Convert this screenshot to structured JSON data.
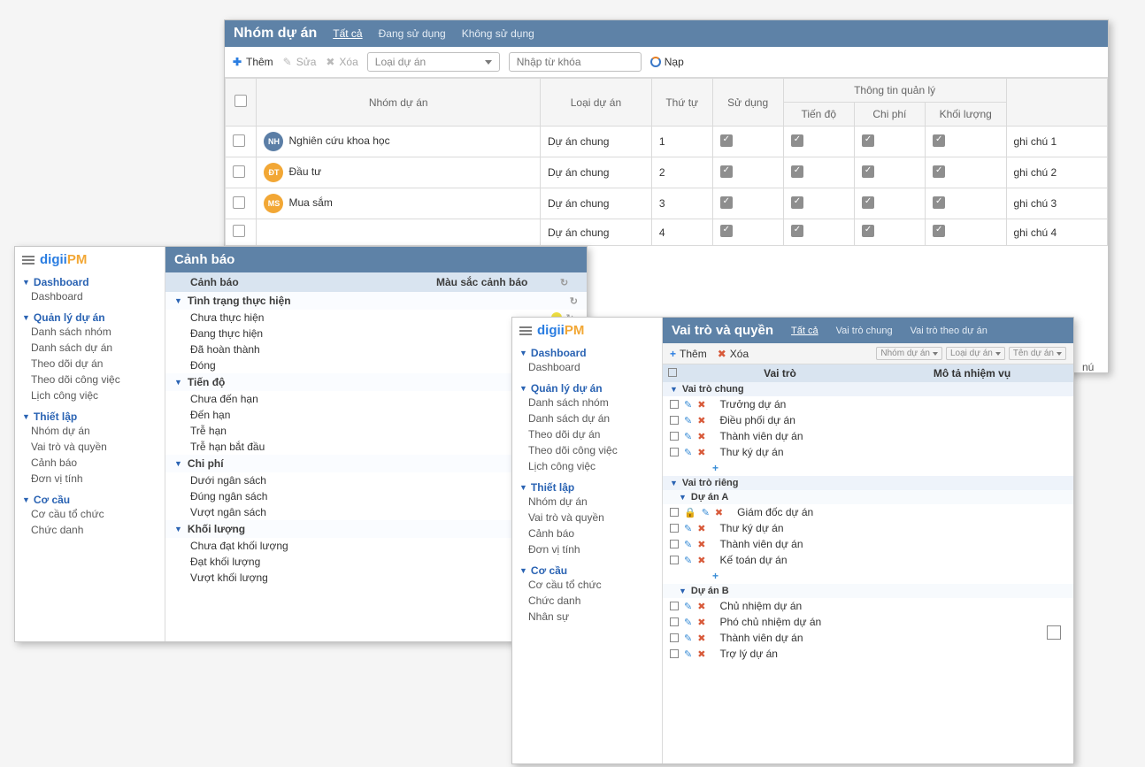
{
  "back": {
    "title": "Nhóm dự án",
    "tabs": [
      "Tất cả",
      "Đang sử dụng",
      "Không sử dụng"
    ],
    "toolbar": {
      "add": "Thêm",
      "edit": "Sửa",
      "del": "Xóa",
      "reload": "Nạp",
      "sel_placeholder": "Loại dự án",
      "search_placeholder": "Nhập từ khóa"
    },
    "headers": {
      "chk": "",
      "name": "Nhóm dự án",
      "type": "Loại dự án",
      "order": "Thứ tự",
      "use": "Sử dụng",
      "info_group": "Thông tin quản lý",
      "prog": "Tiến độ",
      "cost": "Chi phí",
      "vol": "Khối lượng",
      "note": ""
    },
    "rows": [
      {
        "av": "NH",
        "avc": "av-blue",
        "name": "Nghiên cứu khoa học",
        "type": "Dự án chung",
        "order": "1",
        "note": "ghi chú 1"
      },
      {
        "av": "ĐT",
        "avc": "av-orange",
        "name": "Đầu tư",
        "type": "Dự án chung",
        "order": "2",
        "note": "ghi chú 2"
      },
      {
        "av": "MS",
        "avc": "av-orange",
        "name": "Mua sắm",
        "type": "Dự án chung",
        "order": "3",
        "note": "ghi chú 3"
      },
      {
        "av": "",
        "avc": "",
        "name": "",
        "type": "Dự án chung",
        "order": "4",
        "note": "ghi chú 4"
      }
    ],
    "stray_note": "nú"
  },
  "sidebar": {
    "logo1": "digii",
    "logo2": "PM",
    "sections": [
      {
        "head": "Dashboard",
        "items": [
          "Dashboard"
        ]
      },
      {
        "head": "Quản lý dự án",
        "items": [
          "Danh sách nhóm",
          "Danh sách dự án",
          "Theo dõi dự án",
          "Theo dõi công việc",
          "Lịch công việc"
        ]
      },
      {
        "head": "Thiết lập",
        "items": [
          "Nhóm dự án",
          "Vai trò và quyền",
          "Cảnh báo",
          "Đơn vị tính"
        ]
      },
      {
        "head": "Cơ cầu",
        "items": [
          "Cơ cầu tổ chức",
          "Chức danh"
        ]
      }
    ]
  },
  "sidebar_front": {
    "sections": [
      {
        "head": "Dashboard",
        "items": [
          "Dashboard"
        ]
      },
      {
        "head": "Quản lý dự án",
        "items": [
          "Danh sách nhóm",
          "Danh sách dự án",
          "Theo dõi dự án",
          "Theo dõi công việc",
          "Lịch công việc"
        ]
      },
      {
        "head": "Thiết lập",
        "items": [
          "Nhóm dự án",
          "Vai trò và quyền",
          "Cảnh báo",
          "Đơn vị tính"
        ]
      },
      {
        "head": "Cơ cầu",
        "items": [
          "Cơ cầu tổ chức",
          "Chức danh",
          "Nhân sự"
        ]
      }
    ]
  },
  "warn": {
    "title": "Cảnh báo",
    "col1": "Cảnh báo",
    "col2": "Màu sắc cảnh báo",
    "groups": [
      {
        "name": "Tình trạng thực hiện",
        "rows": [
          {
            "label": "Chưa thực hiện",
            "dot": "dot-yellow"
          },
          {
            "label": "Đang thực hiện",
            "dot": "dot-orange"
          },
          {
            "label": "Đã hoàn thành",
            "dot": "dot-cyan"
          },
          {
            "label": "Đóng",
            "dot": "dot-gray"
          }
        ]
      },
      {
        "name": "Tiến độ",
        "rows": [
          {
            "label": "Chưa đến hạn",
            "dot": "dot-orange"
          },
          {
            "label": "Đến hạn",
            "dot": "dot-cyan"
          },
          {
            "label": "Trễ hạn",
            "dot": "dot-brown"
          },
          {
            "label": "Trễ hạn bắt đầu",
            "dot": "dot-red"
          }
        ]
      },
      {
        "name": "Chi phí",
        "rows": [
          {
            "label": "Dưới ngân sách",
            "dot": "dot-gold"
          },
          {
            "label": "Đúng ngân sách",
            "dot": "dot-cyan"
          },
          {
            "label": "Vượt ngân sách",
            "dot": "dot-red"
          }
        ]
      },
      {
        "name": "Khối lượng",
        "rows": [
          {
            "label": "Chưa đạt khối lượng",
            "dot": "dot-orange"
          },
          {
            "label": "Đạt khối lượng",
            "dot": "dot-cyan"
          },
          {
            "label": "Vượt khối lượng",
            "dot": "dot-brown"
          }
        ]
      }
    ]
  },
  "roles": {
    "title": "Vai trò và quyền",
    "tabs": [
      "Tất cả",
      "Vai trò chung",
      "Vai trò theo dự án"
    ],
    "toolbar": {
      "add": "Thêm",
      "del": "Xóa"
    },
    "filters": [
      "Nhóm dự án",
      "Loại dự án",
      "Tên dự án"
    ],
    "thead": {
      "role": "Vai trò",
      "desc": "Mô tả nhiệm vụ"
    },
    "groups": [
      {
        "name": "Vai trò chung",
        "sub": false,
        "rows": [
          "Trưởng dự án",
          "Điều phối dự án",
          "Thành viên dự án",
          "Thư ký dự án"
        ],
        "add": true
      },
      {
        "name": "Vai trò riêng",
        "sub": false,
        "rows": []
      },
      {
        "name": "Dự án A",
        "sub": true,
        "rows": [
          "Giám đốc dự án",
          "Thư ký dự án",
          "Thành viên dự án",
          "Kế toán dự án"
        ],
        "add": true,
        "first_locked": true
      },
      {
        "name": "Dự án B",
        "sub": true,
        "rows": [
          "Chủ nhiệm dự án",
          "Phó chủ nhiệm dự án",
          "Thành viên dự án",
          "Trợ lý dự án"
        ]
      }
    ]
  }
}
